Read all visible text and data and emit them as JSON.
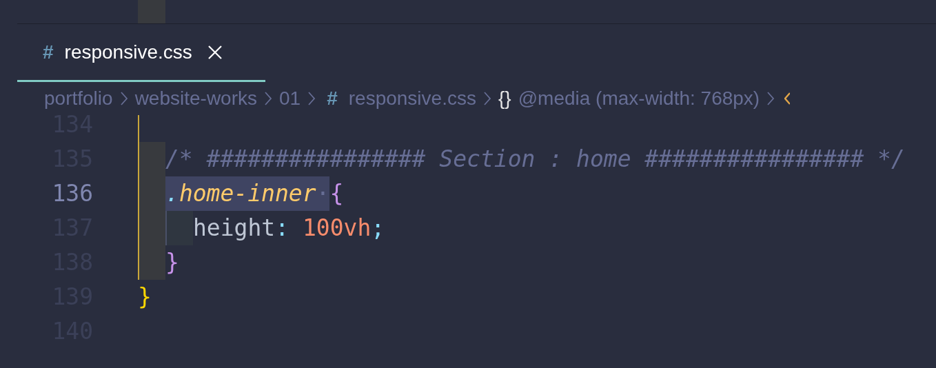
{
  "tabs": [
    {
      "icon": "#",
      "label": "responsive.css",
      "selected": true
    }
  ],
  "breadcrumb": [
    {
      "kind": "folder",
      "text": "portfolio"
    },
    {
      "kind": "folder",
      "text": "website-works"
    },
    {
      "kind": "folder",
      "text": "01"
    },
    {
      "kind": "file",
      "icon": "#",
      "text": "responsive.css"
    },
    {
      "kind": "symbol",
      "icon": "{}",
      "text": "@media (max-width: 768px)"
    },
    {
      "kind": "property-icon"
    }
  ],
  "lines": [
    {
      "number": "134",
      "current": false,
      "guides": [
        {
          "active": true,
          "highlighted": false
        }
      ]
    },
    {
      "number": "135",
      "current": false,
      "guides": [
        {
          "active": true,
          "highlighted": true
        }
      ],
      "tokens": [
        {
          "kind": "comment",
          "text": "/* ################ Section : home ################ */",
          "highlighted": false
        }
      ]
    },
    {
      "number": "136",
      "current": true,
      "guides": [
        {
          "active": true,
          "highlighted": true
        }
      ],
      "tokens": [
        {
          "kind": "selector-dot",
          "text": ".",
          "highlighted": true
        },
        {
          "kind": "selector",
          "text": "home-inner",
          "highlighted": true
        },
        {
          "kind": "whitespace",
          "text": "·",
          "highlighted": true
        },
        {
          "kind": "bracket-2",
          "text": "{",
          "highlighted": false
        }
      ]
    },
    {
      "number": "137",
      "current": false,
      "guides": [
        {
          "active": true,
          "highlighted": true
        },
        {
          "kind": "inner"
        }
      ],
      "tokens": [
        {
          "kind": "property",
          "text": "height",
          "highlighted": false
        },
        {
          "kind": "punct",
          "text": ": ",
          "highlighted": false
        },
        {
          "kind": "number",
          "text": "100vh",
          "highlighted": false
        },
        {
          "kind": "punct",
          "text": ";",
          "highlighted": false
        }
      ]
    },
    {
      "number": "138",
      "current": false,
      "guides": [
        {
          "active": true,
          "highlighted": true
        }
      ],
      "tokens": [
        {
          "kind": "bracket-2",
          "text": "}",
          "highlighted": false
        }
      ]
    },
    {
      "number": "139",
      "current": false,
      "tokens": [
        {
          "kind": "bracket-1",
          "text": "}",
          "highlighted": false
        }
      ]
    },
    {
      "number": "140",
      "current": false
    }
  ]
}
